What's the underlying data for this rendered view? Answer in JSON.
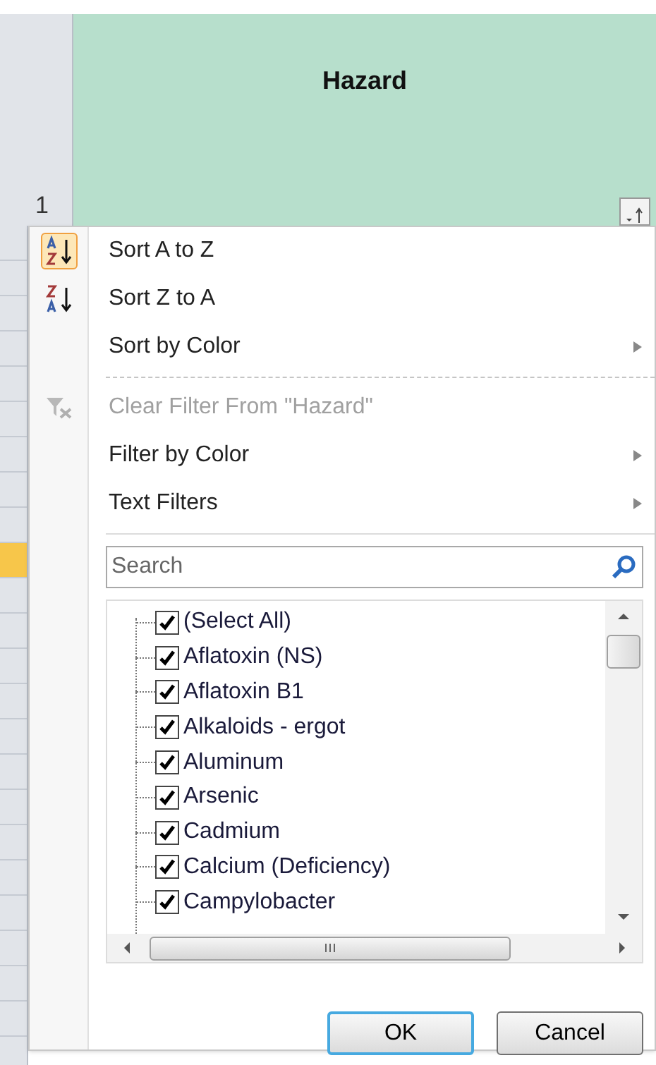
{
  "header": {
    "row_number": "1",
    "column_title": "Hazard"
  },
  "menu_items": [
    {
      "kind": "sort-ascending",
      "label": "Sort A to Z",
      "disabled": false,
      "highlighted": true,
      "submenu": false
    },
    {
      "kind": "sort-descending",
      "label": "Sort Z to A",
      "disabled": false,
      "highlighted": false,
      "submenu": false
    },
    {
      "kind": "plain",
      "label": "Sort by Color",
      "disabled": false,
      "submenu": true
    },
    {
      "kind": "separator"
    },
    {
      "kind": "clear-filter",
      "label": "Clear Filter From \"Hazard\"",
      "disabled": true,
      "highlighted": false,
      "submenu": false
    },
    {
      "kind": "plain",
      "label": "Filter by Color",
      "disabled": false,
      "submenu": true
    },
    {
      "kind": "plain",
      "label": "Text Filters",
      "disabled": false,
      "submenu": true
    }
  ],
  "search": {
    "placeholder": "Search"
  },
  "values": [
    {
      "label": "(Select All)",
      "checked": true
    },
    {
      "label": "Aflatoxin (NS)",
      "checked": true
    },
    {
      "label": "Aflatoxin B1",
      "checked": true
    },
    {
      "label": "Alkaloids - ergot",
      "checked": true
    },
    {
      "label": "Aluminum",
      "checked": true
    },
    {
      "label": "Arsenic",
      "checked": true
    },
    {
      "label": "Cadmium",
      "checked": true
    },
    {
      "label": "Calcium (Deficiency)",
      "checked": true
    },
    {
      "label": "Campylobacter",
      "checked": true
    }
  ],
  "buttons": [
    {
      "label": "OK",
      "default": true
    },
    {
      "label": "Cancel",
      "default": false
    }
  ]
}
